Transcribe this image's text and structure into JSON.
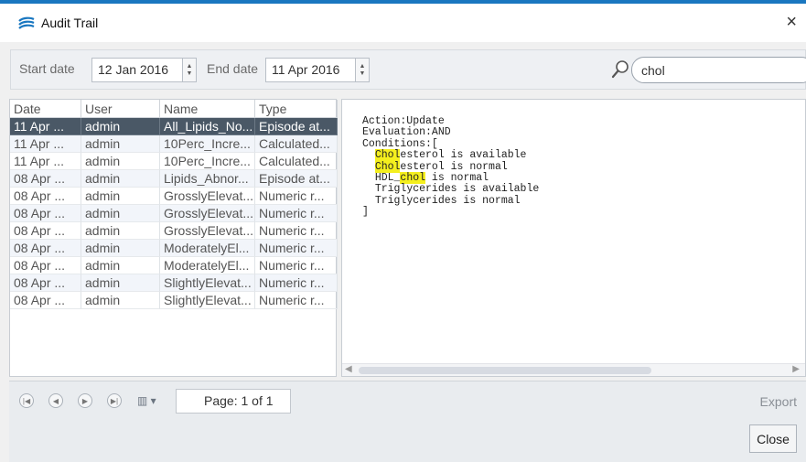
{
  "window": {
    "title": "Audit Trail",
    "close_glyph": "×",
    "accent": "#1a77c0"
  },
  "toolbar": {
    "start_label": "Start date",
    "start_value": "12 Jan 2016",
    "end_label": "End date",
    "end_value": "11 Apr 2016",
    "search_value": "chol"
  },
  "grid": {
    "columns": [
      "Date",
      "User",
      "Name",
      "Type"
    ],
    "rows": [
      {
        "date": "11 Apr ...",
        "user": "admin",
        "name": "All_Lipids_No...",
        "type": "Episode at..."
      },
      {
        "date": "11 Apr ...",
        "user": "admin",
        "name": "10Perc_Incre...",
        "type": "Calculated..."
      },
      {
        "date": "11 Apr ...",
        "user": "admin",
        "name": "10Perc_Incre...",
        "type": "Calculated..."
      },
      {
        "date": "08 Apr ...",
        "user": "admin",
        "name": "Lipids_Abnor...",
        "type": "Episode at..."
      },
      {
        "date": "08 Apr ...",
        "user": "admin",
        "name": "GrosslyElevat...",
        "type": "Numeric r..."
      },
      {
        "date": "08 Apr ...",
        "user": "admin",
        "name": "GrosslyElevat...",
        "type": "Numeric r..."
      },
      {
        "date": "08 Apr ...",
        "user": "admin",
        "name": "GrosslyElevat...",
        "type": "Numeric r..."
      },
      {
        "date": "08 Apr ...",
        "user": "admin",
        "name": "ModeratelyEl...",
        "type": "Numeric r..."
      },
      {
        "date": "08 Apr ...",
        "user": "admin",
        "name": "ModeratelyEl...",
        "type": "Numeric r..."
      },
      {
        "date": "08 Apr ...",
        "user": "admin",
        "name": "SlightlyElevat...",
        "type": "Numeric r..."
      },
      {
        "date": "08 Apr ...",
        "user": "admin",
        "name": "SlightlyElevat...",
        "type": "Numeric r..."
      }
    ],
    "selected_row": 0
  },
  "detail": {
    "line1": "Action:Update",
    "line2": "Evaluation:AND",
    "line3": "Conditions:[",
    "c1_hl": "Chol",
    "c1_rest": "esterol is available",
    "c2_hl": "Chol",
    "c2_rest": "esterol is normal",
    "c3_pre": "HDL_",
    "c3_hl": "chol",
    "c3_rest": " is normal",
    "c4": "Triglycerides is available",
    "c5": "Triglycerides is normal",
    "line_end": "]",
    "highlight_color": "#f4ef1e"
  },
  "footer": {
    "page_label": "Page: 1 of 1",
    "export_label": "Export",
    "close_label": "Close"
  }
}
